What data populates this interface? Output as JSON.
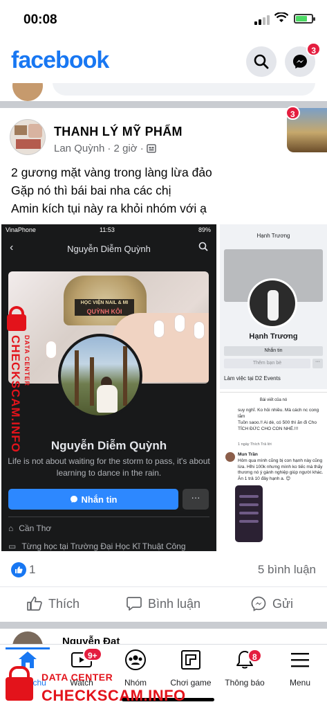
{
  "status_bar": {
    "time": "00:08"
  },
  "header": {
    "logo": "facebook",
    "messenger_badge": "3"
  },
  "post": {
    "group_name": "THANH LÝ MỸ PHẨM",
    "author": "Lan Quỳnh",
    "time": "· 2 giờ ·",
    "story_badge": "3",
    "text_lines": [
      "2 gương mặt vàng trong làng lừa đảo",
      "Gặp nó thì bái bai nha các chị",
      "Amin kích tụi này ra khỏi nhóm với ạ"
    ],
    "image": {
      "left": {
        "carrier": "VinaPhone",
        "time": "11:53",
        "battery": "89%",
        "title": "Nguyễn Diễm Quỳnh",
        "cover_label_line1": "HỌC VIỆN NAIL & MI",
        "cover_label_line2": "QUỲNH KÔI",
        "name": "Nguyễn Diễm Quỳnh",
        "bio": "Life is not about waiting for the storm to pass, it's about learning to dance in the rain.",
        "message_button": "Nhắn tin",
        "more_button": "···",
        "location": "Cần Thơ",
        "education": "Từng học tại Trường Đại Học Kĩ Thuật Công"
      },
      "right_top": {
        "title": "Hạnh Trương",
        "name": "Hạnh Trương",
        "message_button": "Nhắn tin",
        "friend_button": "Thêm bạn bè",
        "more_button": "···",
        "work": "Làm việc tại D2 Events"
      },
      "right_bottom": {
        "title": "Bài viết của nó",
        "comment1": "suy nghĩ. Ko hỏi nhiều. Mà cách nc cong lắm",
        "comment1b": "Tuồn saoo.!! Ai dè, có 500 thì ăn đi Cho TÍCH ĐỨC CHO CON NHÉ.!!!",
        "actions": "1 ngày   Thích   Trả lời",
        "commenter": "Mun Trần",
        "comment2": "Hôm qua mình cũng bị con hạnh này cũng lừa. Hỉhi 100k nhưng mình ko tiếc mà thấy thương nó ý gành nghiệp giúp người khác. Ăn 1 trả 10 đây hạnh a. 😊"
      }
    },
    "like_count": "1",
    "comment_count": "5 bình luận",
    "actions": {
      "like": "Thích",
      "comment": "Bình luận",
      "share": "Gửi"
    }
  },
  "next_post": {
    "author": "Nguyễn Đạt"
  },
  "bottom_nav": {
    "items": [
      {
        "label": "Trang chủ"
      },
      {
        "label": "Watch",
        "badge": "9+"
      },
      {
        "label": "Nhóm"
      },
      {
        "label": "Chơi game"
      },
      {
        "label": "Thông báo",
        "badge": "8"
      },
      {
        "label": "Menu"
      }
    ]
  },
  "watermark": {
    "side_main": "CHECKSCAM.INFO",
    "side_sub": "DATA CENTER",
    "bottom_sub": "DATA CENTER",
    "bottom_main": "CHECKSCAM.INFO"
  },
  "colors": {
    "brand": "#1877f2",
    "badge": "#e41e3f",
    "watermark": "#e3131b"
  }
}
